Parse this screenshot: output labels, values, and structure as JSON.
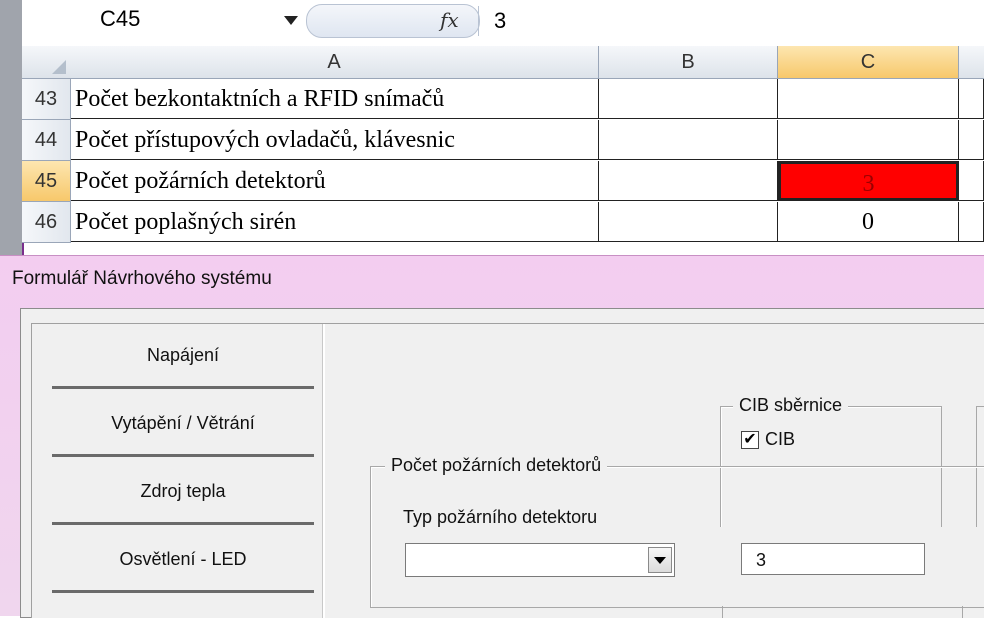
{
  "formula_bar": {
    "name_box": "C45",
    "fx_label": "fx",
    "value": "3"
  },
  "grid": {
    "columns": [
      "A",
      "B",
      "C"
    ],
    "rows": [
      {
        "num": "43",
        "a": "Počet bezkontaktních a RFID snímačů",
        "b": "",
        "c": ""
      },
      {
        "num": "44",
        "a": "Počet přístupových ovladačů, klávesnic",
        "b": "",
        "c": ""
      },
      {
        "num": "45",
        "a": "Počet požárních detektorů",
        "b": "",
        "c": "3"
      },
      {
        "num": "46",
        "a": "Počet poplašných sirén",
        "b": "",
        "c": "0"
      }
    ],
    "selected_cell": "C45",
    "highlight_color": "#ff0000"
  },
  "dialog": {
    "title": "Formulář Návrhového systému",
    "nav": [
      {
        "label": "Napájení"
      },
      {
        "label": "Vytápění / Větrání"
      },
      {
        "label": "Zdroj tepla"
      },
      {
        "label": "Osvětlení - LED"
      }
    ],
    "cib_group": {
      "legend": "CIB sběrnice",
      "checkbox_label": "CIB",
      "checked": true
    },
    "detector_group": {
      "legend": "Počet požárních detektorů",
      "type_label": "Typ požárního detektoru",
      "type_value": "",
      "count_value": "3"
    }
  }
}
